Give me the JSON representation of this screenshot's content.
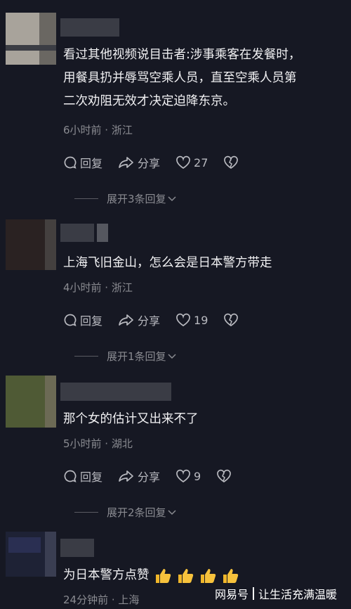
{
  "comments": [
    {
      "text_lines": [
        "看过其他视频说目击者:涉事乘客在发餐时，",
        "用餐具扔并辱骂空乘人员，直至空乘人员第",
        "二次劝阻无效才决定迫降东京。"
      ],
      "meta": "6小时前 · 浙江",
      "reply_label": "回复",
      "share_label": "分享",
      "likes": "27",
      "expand_label": "展开3条回复"
    },
    {
      "text_lines": [
        "上海飞旧金山，怎么会是日本警方带走"
      ],
      "meta": "4小时前 · 浙江",
      "reply_label": "回复",
      "share_label": "分享",
      "likes": "19",
      "expand_label": "展开1条回复"
    },
    {
      "text_lines": [
        "那个女的估计又出来不了"
      ],
      "meta": "5小时前 · 湖北",
      "reply_label": "回复",
      "share_label": "分享",
      "likes": "9",
      "expand_label": "展开2条回复"
    },
    {
      "text_lines": [
        "为日本警方点赞"
      ],
      "meta": "24分钟前 · 上海",
      "emoji": "thumbs-up-emoji"
    }
  ],
  "watermark": {
    "brand": "网易号",
    "account": "让生活充满温暖"
  },
  "icons": [
    "reply-icon",
    "share-icon",
    "like-heart-icon",
    "dislike-heart-icon",
    "chevron-down-icon",
    "thumbs-up-emoji"
  ],
  "colors": {
    "background": "#161823",
    "text": "#f1f1f3",
    "meta": "#8a8b91"
  }
}
